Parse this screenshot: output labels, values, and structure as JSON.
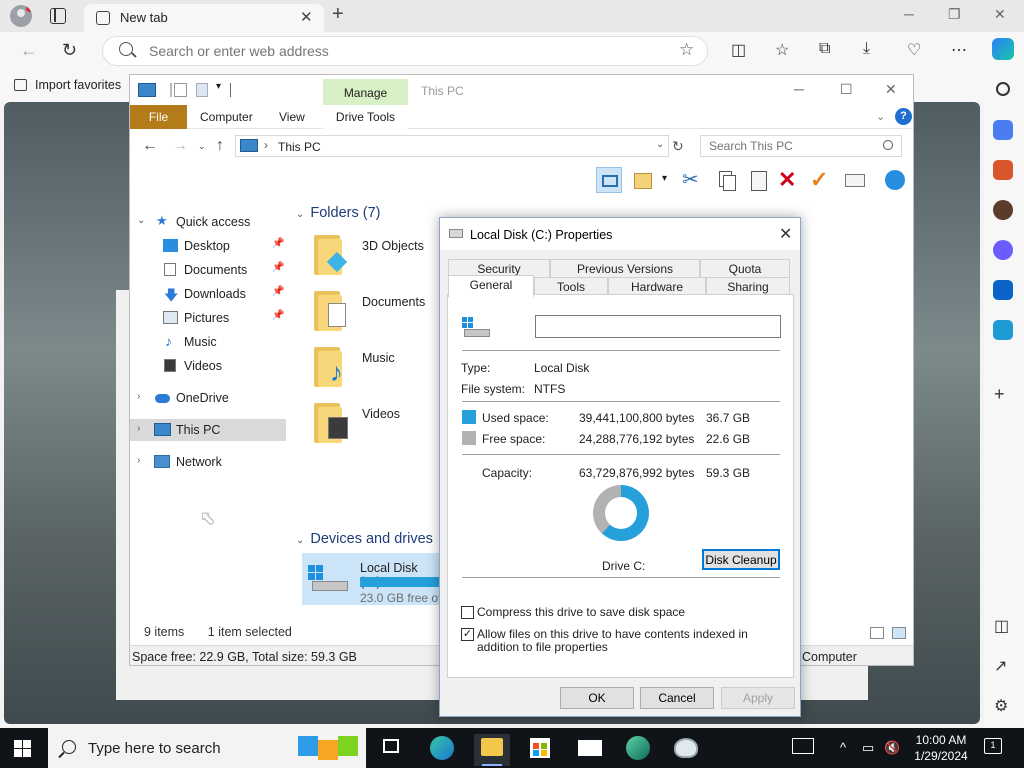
{
  "browser": {
    "tab_title": "New tab",
    "search_placeholder": "Search or enter web address",
    "favorites": {
      "import_label": "Import favorites"
    }
  },
  "explorer": {
    "title": "This PC",
    "context_tab": "Manage",
    "ribbon_tabs": [
      "File",
      "Computer",
      "View",
      "Drive Tools"
    ],
    "path": "This PC",
    "search_placeholder": "Search This PC",
    "nav": [
      {
        "label": "Quick access"
      },
      {
        "label": "Desktop"
      },
      {
        "label": "Documents"
      },
      {
        "label": "Downloads"
      },
      {
        "label": "Pictures"
      },
      {
        "label": "Music"
      },
      {
        "label": "Videos"
      },
      {
        "label": "OneDrive"
      },
      {
        "label": "This PC"
      },
      {
        "label": "Network"
      }
    ],
    "folders_header": "Folders (7)",
    "folders": [
      "3D Objects",
      "Documents",
      "Music",
      "Videos"
    ],
    "devices_header": "Devices and drives",
    "drive": {
      "name": "Local Disk (C:)",
      "free_text": "23.0 GB free of 59.3 GB"
    },
    "status": {
      "items": "9 items",
      "selected": "1 item selected"
    },
    "statusbar": {
      "space": "Space free: 22.9 GB, Total size: 59.3 GB",
      "computer": "Computer"
    }
  },
  "dialog": {
    "title": "Local Disk (C:) Properties",
    "tabs_top": [
      "Security",
      "Previous Versions",
      "Quota"
    ],
    "tabs_bottom": [
      "General",
      "Tools",
      "Hardware",
      "Sharing"
    ],
    "label_value": "",
    "type_label": "Type:",
    "type_value": "Local Disk",
    "fs_label": "File system:",
    "fs_value": "NTFS",
    "used_label": "Used space:",
    "used_bytes": "39,441,100,800 bytes",
    "used_gb": "36.7 GB",
    "free_label": "Free space:",
    "free_bytes": "24,288,776,192 bytes",
    "free_gb": "22.6 GB",
    "capacity_label": "Capacity:",
    "capacity_bytes": "63,729,876,992 bytes",
    "capacity_gb": "59.3 GB",
    "used_fraction": 0.619,
    "drive_label": "Drive C:",
    "cleanup_label": "Disk Cleanup",
    "compress_label": "Compress this drive to save disk space",
    "compress_checked": false,
    "index_label": "Allow files on this drive to have contents indexed in addition to file properties",
    "index_checked": true,
    "ok": "OK",
    "cancel": "Cancel",
    "apply": "Apply",
    "colors": {
      "used": "#26a0da",
      "free": "#b2b2b2"
    }
  },
  "taskbar": {
    "search_placeholder": "Type here to search",
    "time": "10:00 AM",
    "date": "1/29/2024",
    "notification_count": "1"
  }
}
